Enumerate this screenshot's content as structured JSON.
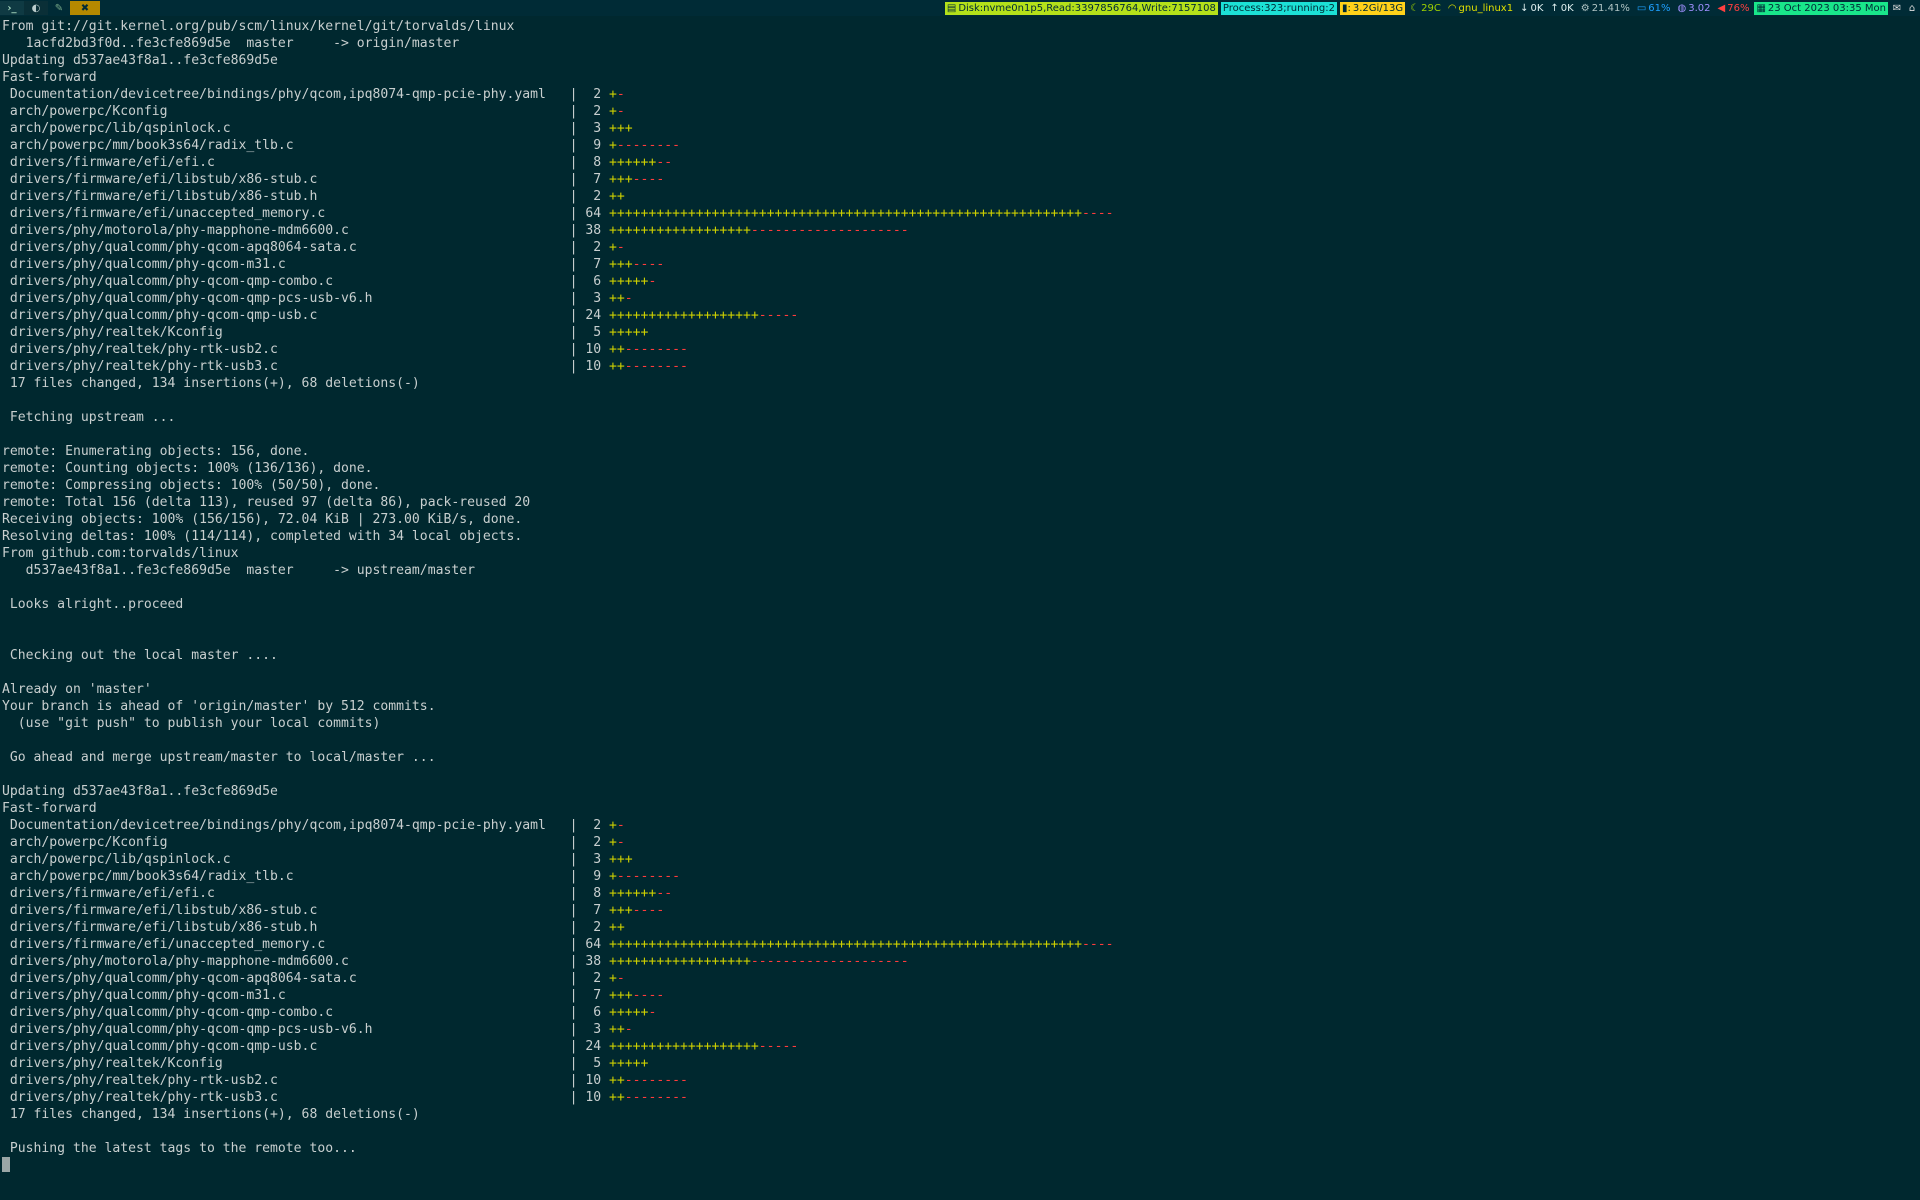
{
  "statusbar": {
    "workspaces": [
      "›_",
      "◐",
      "✎",
      "✖"
    ],
    "disk": "Disk:nvme0n1p5,Read:3397856764,Write:7157108",
    "process": "Process:323;running:2",
    "memory": "3.2Gi/13G",
    "temp": "29C",
    "wifi": "gnu_linux1",
    "net_down": "0K",
    "net_up": "0K",
    "cpu": "21.41%",
    "battery": "61%",
    "load": "3.02",
    "volume": "76%",
    "date": "23 Oct 2023 03:35 Mon",
    "icons": {
      "disk": "disk-icon",
      "memory": "chart-icon",
      "temp": "moon-icon",
      "wifi": "wifi-icon",
      "down": "arrow-down-icon",
      "up": "arrow-up-icon",
      "cpu": "gear-icon",
      "battery": "battery-icon",
      "load": "load-icon",
      "volume": "speaker-icon",
      "date": "calendar-icon",
      "tray1": "mail-icon",
      "tray2": "network-tray-icon"
    }
  },
  "terminal": {
    "sections": [
      {
        "type": "text",
        "lines": [
          "From git://git.kernel.org/pub/scm/linux/kernel/git/torvalds/linux",
          "   1acfd2bd3f0d..fe3cfe869d5e  master     -> origin/master",
          "Updating d537ae43f8a1..fe3cfe869d5e",
          "Fast-forward"
        ]
      },
      {
        "type": "diffstat",
        "files": [
          {
            "path": "Documentation/devicetree/bindings/phy/qcom,ipq8074-qmp-pcie-phy.yaml",
            "count": "2",
            "plus": "+",
            "minus": "-"
          },
          {
            "path": "arch/powerpc/Kconfig",
            "count": "2",
            "plus": "+",
            "minus": "-"
          },
          {
            "path": "arch/powerpc/lib/qspinlock.c",
            "count": "3",
            "plus": "+++",
            "minus": ""
          },
          {
            "path": "arch/powerpc/mm/book3s64/radix_tlb.c",
            "count": "9",
            "plus": "+",
            "minus": "--------"
          },
          {
            "path": "drivers/firmware/efi/efi.c",
            "count": "8",
            "plus": "++++++",
            "minus": "--"
          },
          {
            "path": "drivers/firmware/efi/libstub/x86-stub.c",
            "count": "7",
            "plus": "+++",
            "minus": "----"
          },
          {
            "path": "drivers/firmware/efi/libstub/x86-stub.h",
            "count": "2",
            "plus": "++",
            "minus": ""
          },
          {
            "path": "drivers/firmware/efi/unaccepted_memory.c",
            "count": "64",
            "plus": "++++++++++++++++++++++++++++++++++++++++++++++++++++++++++++",
            "minus": "----"
          },
          {
            "path": "drivers/phy/motorola/phy-mapphone-mdm6600.c",
            "count": "38",
            "plus": "++++++++++++++++++",
            "minus": "--------------------"
          },
          {
            "path": "drivers/phy/qualcomm/phy-qcom-apq8064-sata.c",
            "count": "2",
            "plus": "+",
            "minus": "-"
          },
          {
            "path": "drivers/phy/qualcomm/phy-qcom-m31.c",
            "count": "7",
            "plus": "+++",
            "minus": "----"
          },
          {
            "path": "drivers/phy/qualcomm/phy-qcom-qmp-combo.c",
            "count": "6",
            "plus": "+++++",
            "minus": "-"
          },
          {
            "path": "drivers/phy/qualcomm/phy-qcom-qmp-pcs-usb-v6.h",
            "count": "3",
            "plus": "++",
            "minus": "-"
          },
          {
            "path": "drivers/phy/qualcomm/phy-qcom-qmp-usb.c",
            "count": "24",
            "plus": "+++++++++++++++++++",
            "minus": "-----"
          },
          {
            "path": "drivers/phy/realtek/Kconfig",
            "count": "5",
            "plus": "+++++",
            "minus": ""
          },
          {
            "path": "drivers/phy/realtek/phy-rtk-usb2.c",
            "count": "10",
            "plus": "++",
            "minus": "--------"
          },
          {
            "path": "drivers/phy/realtek/phy-rtk-usb3.c",
            "count": "10",
            "plus": "++",
            "minus": "--------"
          }
        ]
      },
      {
        "type": "text",
        "lines": [
          " 17 files changed, 134 insertions(+), 68 deletions(-)",
          "",
          " Fetching upstream ...",
          "",
          "remote: Enumerating objects: 156, done.",
          "remote: Counting objects: 100% (136/136), done.",
          "remote: Compressing objects: 100% (50/50), done.",
          "remote: Total 156 (delta 113), reused 97 (delta 86), pack-reused 20",
          "Receiving objects: 100% (156/156), 72.04 KiB | 273.00 KiB/s, done.",
          "Resolving deltas: 100% (114/114), completed with 34 local objects.",
          "From github.com:torvalds/linux",
          "   d537ae43f8a1..fe3cfe869d5e  master     -> upstream/master",
          "",
          " Looks alright..proceed",
          "",
          "",
          " Checking out the local master ....",
          "",
          "Already on 'master'",
          "Your branch is ahead of 'origin/master' by 512 commits.",
          "  (use \"git push\" to publish your local commits)",
          "",
          " Go ahead and merge upstream/master to local/master ...",
          "",
          "Updating d537ae43f8a1..fe3cfe869d5e",
          "Fast-forward"
        ]
      },
      {
        "type": "diffstat",
        "files": [
          {
            "path": "Documentation/devicetree/bindings/phy/qcom,ipq8074-qmp-pcie-phy.yaml",
            "count": "2",
            "plus": "+",
            "minus": "-"
          },
          {
            "path": "arch/powerpc/Kconfig",
            "count": "2",
            "plus": "+",
            "minus": "-"
          },
          {
            "path": "arch/powerpc/lib/qspinlock.c",
            "count": "3",
            "plus": "+++",
            "minus": ""
          },
          {
            "path": "arch/powerpc/mm/book3s64/radix_tlb.c",
            "count": "9",
            "plus": "+",
            "minus": "--------"
          },
          {
            "path": "drivers/firmware/efi/efi.c",
            "count": "8",
            "plus": "++++++",
            "minus": "--"
          },
          {
            "path": "drivers/firmware/efi/libstub/x86-stub.c",
            "count": "7",
            "plus": "+++",
            "minus": "----"
          },
          {
            "path": "drivers/firmware/efi/libstub/x86-stub.h",
            "count": "2",
            "plus": "++",
            "minus": ""
          },
          {
            "path": "drivers/firmware/efi/unaccepted_memory.c",
            "count": "64",
            "plus": "++++++++++++++++++++++++++++++++++++++++++++++++++++++++++++",
            "minus": "----"
          },
          {
            "path": "drivers/phy/motorola/phy-mapphone-mdm6600.c",
            "count": "38",
            "plus": "++++++++++++++++++",
            "minus": "--------------------"
          },
          {
            "path": "drivers/phy/qualcomm/phy-qcom-apq8064-sata.c",
            "count": "2",
            "plus": "+",
            "minus": "-"
          },
          {
            "path": "drivers/phy/qualcomm/phy-qcom-m31.c",
            "count": "7",
            "plus": "+++",
            "minus": "----"
          },
          {
            "path": "drivers/phy/qualcomm/phy-qcom-qmp-combo.c",
            "count": "6",
            "plus": "+++++",
            "minus": "-"
          },
          {
            "path": "drivers/phy/qualcomm/phy-qcom-qmp-pcs-usb-v6.h",
            "count": "3",
            "plus": "++",
            "minus": "-"
          },
          {
            "path": "drivers/phy/qualcomm/phy-qcom-qmp-usb.c",
            "count": "24",
            "plus": "+++++++++++++++++++",
            "minus": "-----"
          },
          {
            "path": "drivers/phy/realtek/Kconfig",
            "count": "5",
            "plus": "+++++",
            "minus": ""
          },
          {
            "path": "drivers/phy/realtek/phy-rtk-usb2.c",
            "count": "10",
            "plus": "++",
            "minus": "--------"
          },
          {
            "path": "drivers/phy/realtek/phy-rtk-usb3.c",
            "count": "10",
            "plus": "++",
            "minus": "--------"
          }
        ]
      },
      {
        "type": "text",
        "lines": [
          " 17 files changed, 134 insertions(+), 68 deletions(-)",
          "",
          " Pushing the latest tags to the remote too...",
          ""
        ]
      }
    ]
  },
  "colors": {
    "background": "#00282f",
    "text": "#c8cfcf",
    "insertion": "#cfd100",
    "deletion": "#ff3c3c"
  }
}
